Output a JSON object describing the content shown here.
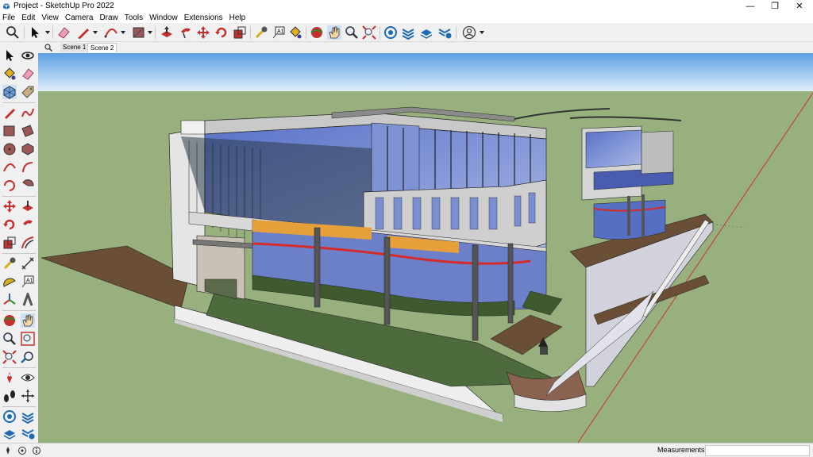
{
  "window": {
    "title": "Project - SketchUp Pro 2022",
    "minimize_glyph": "—",
    "restore_glyph": "❐",
    "close_glyph": "✕"
  },
  "menu": [
    "File",
    "Edit",
    "View",
    "Camera",
    "Draw",
    "Tools",
    "Window",
    "Extensions",
    "Help"
  ],
  "scenes": [
    "Scene 1",
    "Scene 2"
  ],
  "active_scene": "Scene 2",
  "status": {
    "measurements_label": "Measurements",
    "measurements_value": ""
  },
  "icons": {
    "top_toolbar": [
      "search-icon",
      "select-arrow-icon",
      "eraser-icon",
      "pencil-icon",
      "arc-icon",
      "shape-icon",
      "push-pull-icon",
      "follow-me-icon",
      "move-icon",
      "rotate-icon",
      "scale-icon",
      "tape-measure-icon",
      "text-icon",
      "paint-bucket-icon",
      "orbit-icon",
      "pan-icon",
      "zoom-icon",
      "zoom-extents-icon",
      "warehouse-icon",
      "extension-warehouse-icon",
      "layout-icon",
      "send-to-layout-icon",
      "account-icon"
    ],
    "left_toolbar": [
      "select-icon",
      "orbit-icon",
      "paint-bucket-icon",
      "eraser-icon",
      "component-icon",
      "tag-icon",
      "line-icon",
      "freehand-icon",
      "rectangle-icon",
      "rotated-rectangle-icon",
      "circle-icon",
      "polygon-icon",
      "arc-icon",
      "two-point-arc-icon",
      "three-point-arc-icon",
      "pie-icon",
      "move-icon",
      "push-pull-icon",
      "rotate-icon",
      "follow-me-icon",
      "scale-icon",
      "offset-icon",
      "tape-measure-icon",
      "dimension-icon",
      "protractor-icon",
      "text-icon",
      "axes-icon",
      "3d-text-icon",
      "orbit-icon",
      "pan-icon",
      "zoom-icon",
      "zoom-window-icon",
      "zoom-extents-icon",
      "previous-view-icon",
      "position-camera-icon",
      "look-around-icon",
      "walk-icon",
      "section-plane-icon",
      "warehouse-icon",
      "extension-warehouse-icon",
      "layout-icon",
      "send-to-layout-icon"
    ]
  },
  "colors": {
    "sky_top": "#5b9fe4",
    "sky_bottom": "#dfeefa",
    "ground": "#97b07e",
    "accent_blue": "#1e6ab4",
    "accent_red": "#d42a2a"
  }
}
